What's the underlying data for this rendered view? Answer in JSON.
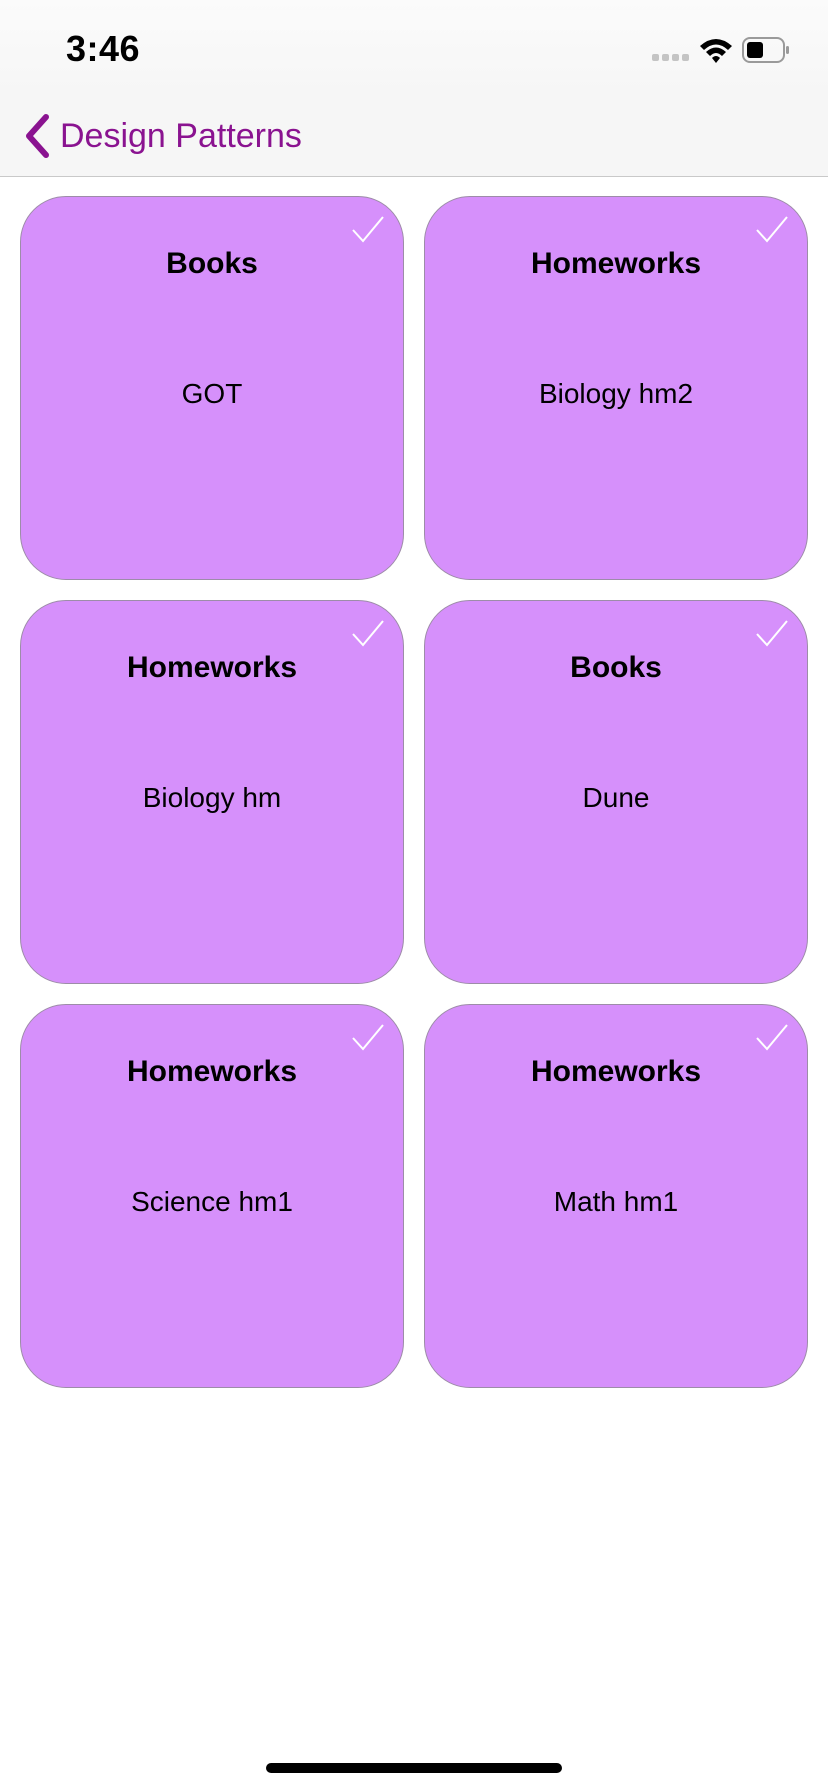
{
  "status_bar": {
    "time": "3:46",
    "icons": [
      "cellular-signal-icon",
      "wifi-icon",
      "battery-icon"
    ]
  },
  "nav": {
    "back_icon": "chevron-left-icon",
    "back_label": "Design Patterns"
  },
  "colors": {
    "accent": "#8a1390",
    "card_background": "#d690fb",
    "checkmark": "#ffffff"
  },
  "cards": [
    {
      "title": "Books",
      "subtitle": "GOT",
      "icon": "checkmark-icon"
    },
    {
      "title": "Homeworks",
      "subtitle": "Biology hm2",
      "icon": "checkmark-icon"
    },
    {
      "title": "Homeworks",
      "subtitle": "Biology hm",
      "icon": "checkmark-icon"
    },
    {
      "title": "Books",
      "subtitle": "Dune",
      "icon": "checkmark-icon"
    },
    {
      "title": "Homeworks",
      "subtitle": "Science hm1",
      "icon": "checkmark-icon"
    },
    {
      "title": "Homeworks",
      "subtitle": "Math hm1",
      "icon": "checkmark-icon"
    }
  ]
}
